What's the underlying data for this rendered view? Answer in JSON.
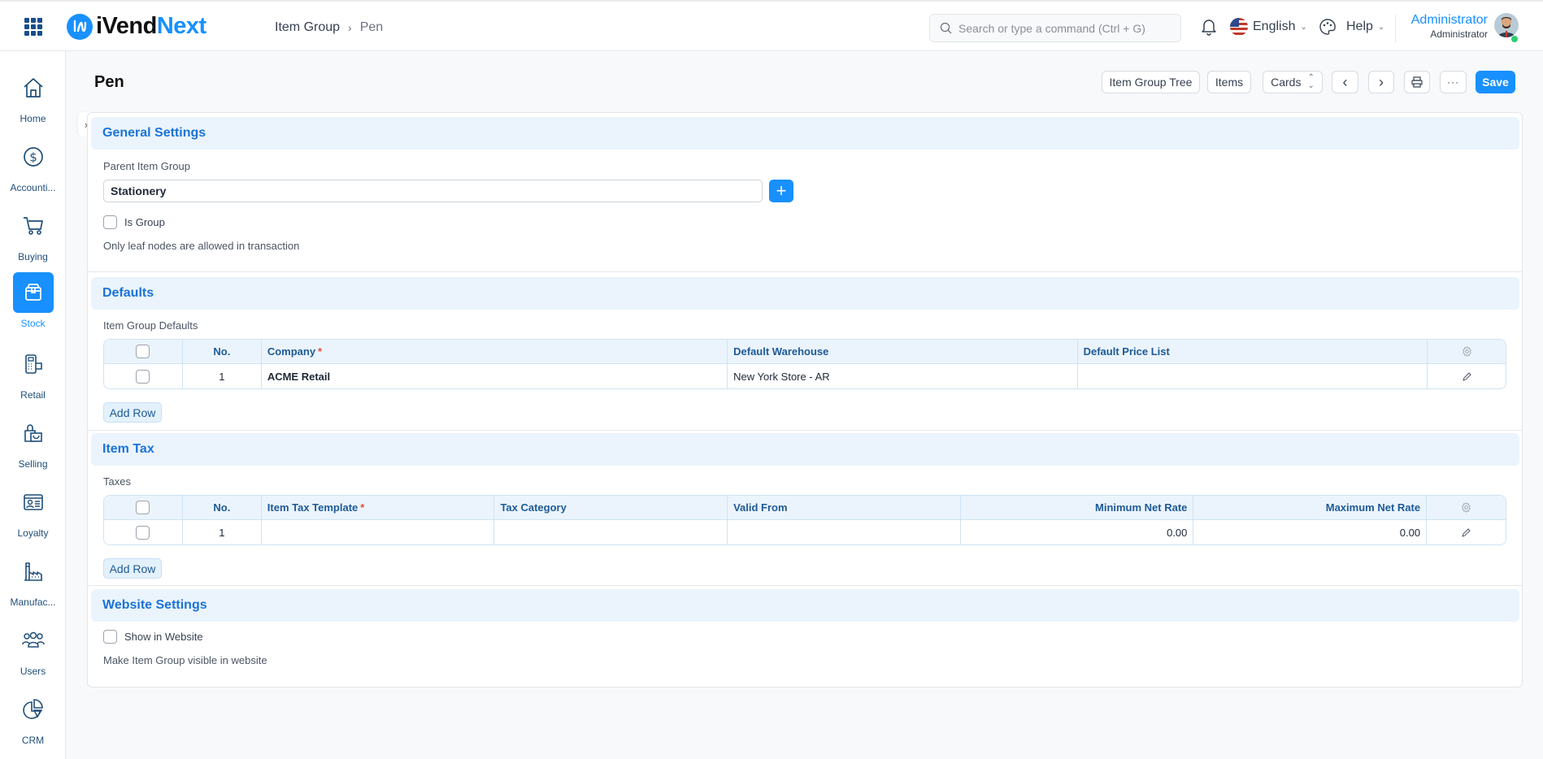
{
  "app": {
    "brand_a": "iVend",
    "brand_b": "Next"
  },
  "breadcrumb": {
    "items": [
      "Item Group",
      "Pen"
    ]
  },
  "search": {
    "placeholder": "Search or type a command (Ctrl + G)"
  },
  "navbar": {
    "language": "English",
    "help": "Help",
    "user_name": "Administrator",
    "user_role": "Administrator"
  },
  "sidebar": {
    "items": [
      {
        "label": "Home",
        "icon": "home-icon",
        "active": false
      },
      {
        "label": "Accounti...",
        "icon": "dollar-circle-icon",
        "active": false
      },
      {
        "label": "Buying",
        "icon": "cart-icon",
        "active": false
      },
      {
        "label": "Stock",
        "icon": "box-icon",
        "active": true
      },
      {
        "label": "Retail",
        "icon": "pos-terminal-icon",
        "active": false
      },
      {
        "label": "Selling",
        "icon": "shopping-bag-icon",
        "active": false
      },
      {
        "label": "Loyalty",
        "icon": "id-card-icon",
        "active": false
      },
      {
        "label": "Manufac...",
        "icon": "factory-icon",
        "active": false
      },
      {
        "label": "Users",
        "icon": "users-icon",
        "active": false
      },
      {
        "label": "CRM",
        "icon": "pie-chart-icon",
        "active": false
      }
    ]
  },
  "page": {
    "title": "Pen",
    "toolbar": {
      "item_group_tree": "Item Group Tree",
      "items": "Items",
      "view_select": "Cards",
      "save": "Save"
    }
  },
  "general": {
    "title": "General Settings",
    "parent_label": "Parent Item Group",
    "parent_value": "Stationery",
    "is_group_label": "Is Group",
    "is_group_checked": false,
    "is_group_desc": "Only leaf nodes are allowed in transaction"
  },
  "defaults": {
    "title": "Defaults",
    "table_label": "Item Group Defaults",
    "columns": [
      "No.",
      "Company",
      "Default Warehouse",
      "Default Price List"
    ],
    "required_mark": "*",
    "rows": [
      {
        "no": "1",
        "company": "ACME Retail",
        "warehouse": "New York Store - AR",
        "price_list": ""
      }
    ],
    "add_row": "Add Row"
  },
  "item_tax": {
    "title": "Item Tax",
    "table_label": "Taxes",
    "columns": [
      "No.",
      "Item Tax Template",
      "Tax Category",
      "Valid From",
      "Minimum Net Rate",
      "Maximum Net Rate"
    ],
    "required_mark": "*",
    "rows": [
      {
        "no": "1",
        "template": "",
        "category": "",
        "valid_from": "",
        "min_rate": "0.00",
        "max_rate": "0.00"
      }
    ],
    "add_row": "Add Row"
  },
  "website": {
    "title": "Website Settings",
    "show_label": "Show in Website",
    "show_checked": false,
    "desc": "Make Item Group visible in website"
  }
}
